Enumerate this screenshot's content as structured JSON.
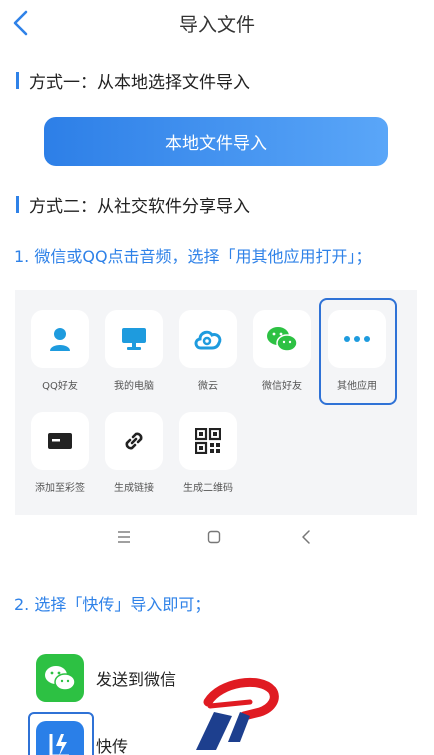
{
  "header": {
    "title": "导入文件"
  },
  "method1": {
    "label": "方式一：从本地选择文件导入",
    "button": "本地文件导入"
  },
  "method2": {
    "label": "方式二：从社交软件分享导入"
  },
  "step1": "1. 微信或QQ点击音频，选择「用其他应用打开」；",
  "share_items": [
    {
      "label": "QQ好友",
      "icon": "qq-friend-icon"
    },
    {
      "label": "我的电脑",
      "icon": "computer-icon"
    },
    {
      "label": "微云",
      "icon": "weiyun-icon"
    },
    {
      "label": "微信好友",
      "icon": "wechat-icon"
    },
    {
      "label": "其他应用",
      "icon": "more-icon"
    },
    {
      "label": "添加至彩签",
      "icon": "note-icon"
    },
    {
      "label": "生成链接",
      "icon": "link-icon"
    },
    {
      "label": "生成二维码",
      "icon": "qrcode-icon"
    }
  ],
  "step2": "2. 选择「快传」导入即可；",
  "apps": [
    {
      "label": "发送到微信",
      "icon": "wechat-icon"
    },
    {
      "label": "快传",
      "icon": "kuaichuan-icon"
    }
  ],
  "colors": {
    "accent": "#2f82e8",
    "wechat": "#2dc143",
    "icon_blue": "#1e9bde"
  }
}
